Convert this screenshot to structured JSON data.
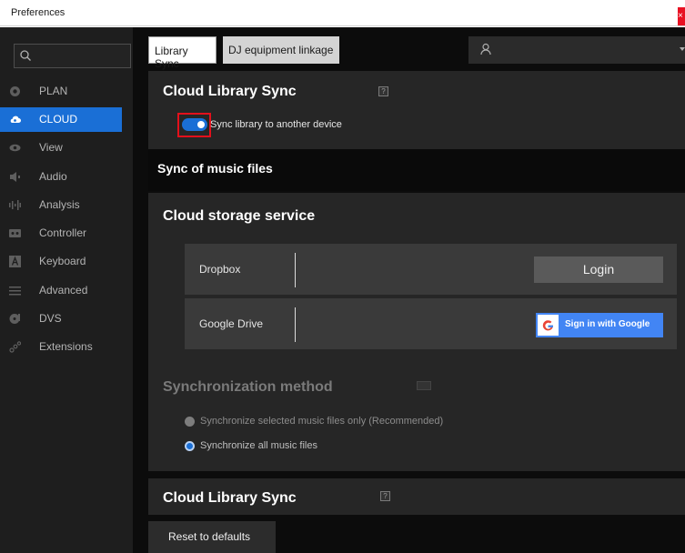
{
  "window": {
    "title": "Preferences",
    "close_label": "×"
  },
  "sidebar": {
    "search_placeholder": "",
    "items": [
      {
        "label": "PLAN",
        "icon": "plan-icon",
        "active": false
      },
      {
        "label": "CLOUD",
        "icon": "cloud-icon",
        "active": true
      },
      {
        "label": "View",
        "icon": "eye-icon",
        "active": false
      },
      {
        "label": "Audio",
        "icon": "speaker-icon",
        "active": false
      },
      {
        "label": "Analysis",
        "icon": "waveform-icon",
        "active": false
      },
      {
        "label": "Controller",
        "icon": "controller-icon",
        "active": false
      },
      {
        "label": "Keyboard",
        "icon": "keyboard-icon",
        "active": false
      },
      {
        "label": "Advanced",
        "icon": "menu-icon",
        "active": false
      },
      {
        "label": "DVS",
        "icon": "dvs-icon",
        "active": false
      },
      {
        "label": "Extensions",
        "icon": "extensions-icon",
        "active": false
      }
    ]
  },
  "tabs": [
    {
      "label": "Library Sync",
      "active": true
    },
    {
      "label": "DJ equipment linkage",
      "active": false
    }
  ],
  "cloud_library_sync": {
    "heading": "Cloud Library Sync",
    "help": "?",
    "toggle_label": "Sync library to another device",
    "toggle_on": true
  },
  "music_sync": {
    "heading": "Sync of music files"
  },
  "cloud_storage": {
    "heading": "Cloud storage service",
    "dropbox": {
      "name": "Dropbox",
      "button": "Login"
    },
    "google": {
      "name": "Google Drive",
      "button": "Sign in with Google",
      "logo": "G"
    }
  },
  "sync_method": {
    "heading": "Synchronization method",
    "options": [
      {
        "label": "Synchronize selected music files only (Recommended)",
        "selected": false
      },
      {
        "label": "Synchronize all music files",
        "selected": true
      }
    ]
  },
  "cloud_library_sync_2": {
    "heading": "Cloud Library Sync",
    "help": "?"
  },
  "footer": {
    "reset_label": "Reset to defaults"
  },
  "colors": {
    "accent": "#1a6fd6",
    "highlight_border": "#e3101b",
    "google_blue": "#4285f4",
    "panel": "#262626",
    "background": "#0c0c0c"
  }
}
